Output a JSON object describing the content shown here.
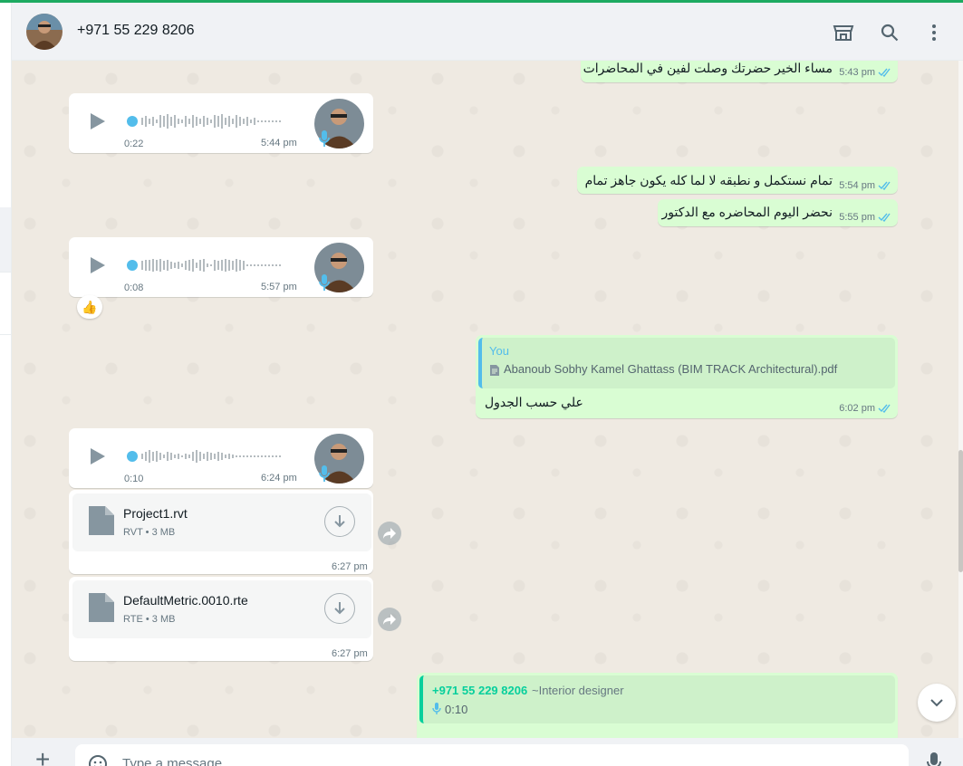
{
  "header": {
    "title": "+971 55 229 8206",
    "icons": [
      "avatar",
      "store-icon",
      "search-icon",
      "menu-dots-icon"
    ]
  },
  "messages": {
    "m1": {
      "text": "مساء الخير حضرتك وصلت لفين في المحاضرات",
      "time": "5:43 pm"
    },
    "v1": {
      "duration": "0:22",
      "time": "5:44 pm"
    },
    "m2": {
      "text": "تمام نستكمل و نطبقه لا لما كله يكون جاهز تمام",
      "time": "5:54 pm"
    },
    "m3": {
      "text": "نحضر اليوم المحاضره مع الدكتور",
      "time": "5:55 pm"
    },
    "v2": {
      "duration": "0:08",
      "time": "5:57 pm",
      "reaction": "👍"
    },
    "m4": {
      "quote_author": "You",
      "quote_file": "Abanoub Sobhy Kamel Ghattass (BIM TRACK Architectural).pdf",
      "text": "علي حسب الجدول",
      "time": "6:02 pm"
    },
    "v3": {
      "duration": "0:10",
      "time": "6:24 pm"
    },
    "d1": {
      "name": "Project1.rvt",
      "meta": "RVT • 3 MB",
      "time": "6:27 pm"
    },
    "d2": {
      "name": "DefaultMetric.0010.rte",
      "meta": "RTE • 3 MB",
      "time": "6:27 pm"
    },
    "m5": {
      "quote_author": "+971 55 229 8206",
      "quote_name": "~Interior designer",
      "quote_duration": "0:10"
    }
  },
  "composer": {
    "placeholder": "Type a message"
  },
  "colors": {
    "accent": "#1daa61",
    "out_bubble": "#d9fdd3",
    "in_bubble": "#ffffff",
    "tick": "#53bdeb",
    "chat_bg": "#efeae2"
  }
}
